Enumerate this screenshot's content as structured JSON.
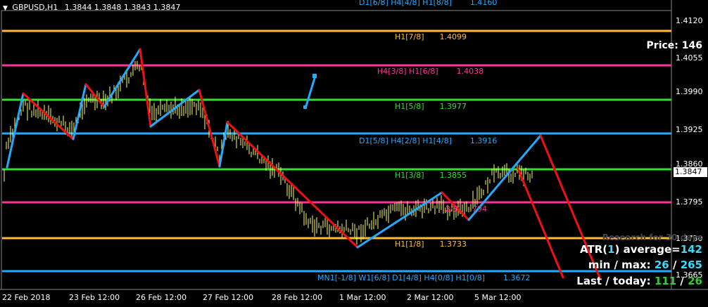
{
  "header": {
    "symbol_timeframe": "GBPUSD,H1",
    "ohlc": "1.3844 1.3848 1.3843 1.3847"
  },
  "price_axis": {
    "ticks": [
      "1.4120",
      "1.4055",
      "1.3990",
      "1.3925",
      "1.3860",
      "1.3795",
      "1.3730",
      "1.3665"
    ],
    "current_price": "1.3847"
  },
  "time_axis": {
    "ticks": [
      "22 Feb 2018",
      "23 Feb 12:00",
      "26 Feb 12:00",
      "27 Feb 12:00",
      "28 Feb 12:00",
      "1 Mar 12:00",
      "2 Mar 12:00",
      "5 Mar 12:00"
    ]
  },
  "levels": {
    "top_label": "D1[6/8] H4[4/8] H1[8/8]",
    "top_value": "1.4160",
    "h1_7_8_label": "H1[7/8]",
    "h1_7_8_value": "1.4099",
    "h4_3_8_label": "H4[3/8] H1[6/8]",
    "h4_3_8_value": "1.4038",
    "h1_5_8_label": "H1[5/8]",
    "h1_5_8_value": "1.3977",
    "d1_5_8_label": "D1[5/8] H4[2/8] H1[4/8]",
    "d1_5_8_value": "1.3916",
    "h1_3_8_label": "H1[3/8]",
    "h1_3_8_value": "1.3855",
    "h1_2_8_label": "2/8]",
    "h1_2_8_value": "794",
    "h1_1_8_label": "H1[1/8]",
    "h1_1_8_value": "1.3733",
    "bottom_label": "MN1[-1/8] W1[6/8] D1[4/8] H4[0/8] H1[0/8]",
    "bottom_value": "1.3672"
  },
  "info_panel": {
    "price_label": "Price:",
    "price_value": "146",
    "research_text": "Research for 30 days",
    "atr_prefix": "ATR(",
    "atr_period": "1",
    "atr_suffix": ") average=",
    "atr_average": "142",
    "minmax_label": "min / max:",
    "min_value": "26",
    "max_sep": "/",
    "max_value": "265",
    "last_label": "Last / today:",
    "last_value": "111",
    "today_sep": "/",
    "today_value": "26"
  },
  "colors": {
    "background": "#000000",
    "candles": "#ffff66",
    "zigzag_up": "#22aaff",
    "zigzag_down": "#ee1111",
    "level_orange": "#ffbb33",
    "level_magenta": "#ff3399",
    "level_green": "#33dd33",
    "level_blue": "#22aaff",
    "accent_green": "#33cc33",
    "accent_cyan": "#33ddff"
  }
}
